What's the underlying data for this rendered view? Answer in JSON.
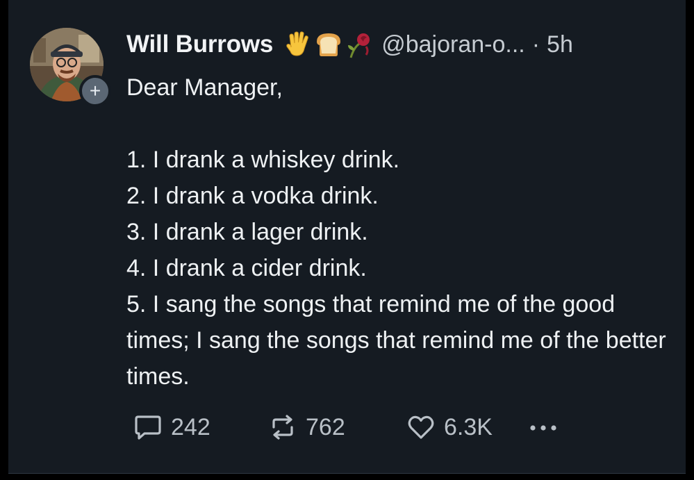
{
  "post": {
    "author_name": "Will Burrows",
    "author_emojis": [
      "vulcan-salute-emoji",
      "bread-emoji",
      "wilted-rose-emoji"
    ],
    "handle": "@bajoran-o...",
    "separator": "·",
    "time_ago": "5h",
    "follow_symbol": "+",
    "greeting": "Dear Manager,",
    "lines": [
      "1. I drank a whiskey drink.",
      "2. I drank a vodka drink.",
      "3. I drank a lager drink.",
      "4. I drank a cider drink.",
      "5. I sang the songs that remind me of the good times; I sang the songs that remind me of the better times."
    ]
  },
  "actions": {
    "replies": "242",
    "reposts": "762",
    "likes": "6.3K",
    "more_icon": "ellipsis-icon"
  },
  "colors": {
    "background": "#000000",
    "card": "#151b22",
    "text": "#eef1f3",
    "muted": "#b9c0c7"
  }
}
